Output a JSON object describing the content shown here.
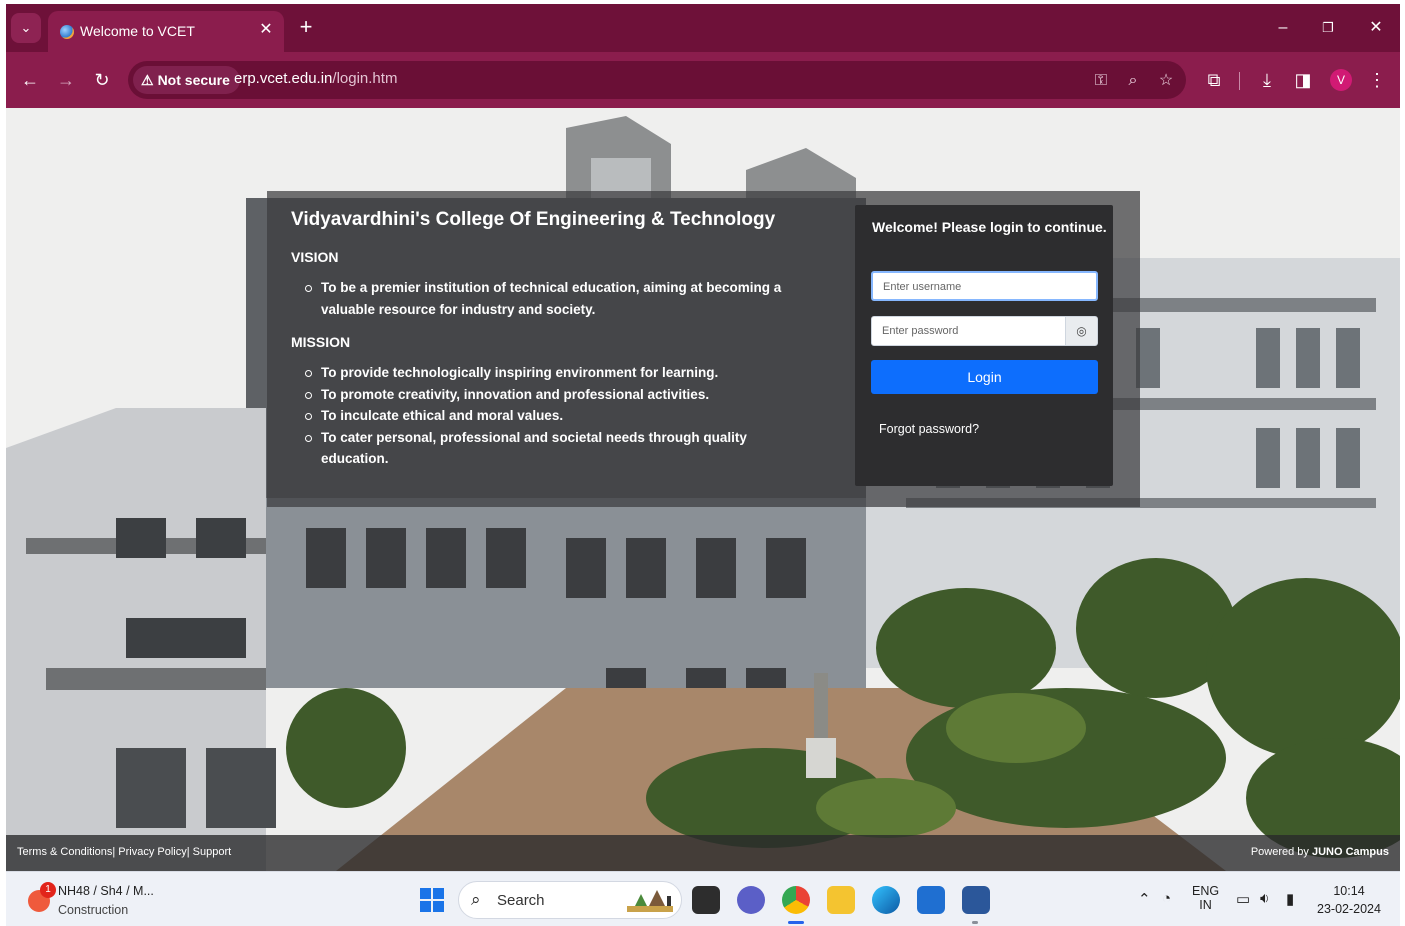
{
  "browser": {
    "tab_title": "Welcome to VCET",
    "security_label": "Not secure",
    "url_host": "erp.vcet.edu.in",
    "url_path": "/login.htm",
    "profile_initial": "V",
    "theme_color": "#8b1d4d"
  },
  "page": {
    "college_name": "Vidyavardhini's College Of Engineering & Technology",
    "vision_heading": "VISION",
    "vision_items": [
      "To be a premier institution of technical education, aiming at becoming a valuable resource for industry and society."
    ],
    "mission_heading": "MISSION",
    "mission_items": [
      "To provide technologically inspiring environment for learning.",
      "To promote creativity, innovation and professional activities.",
      "To inculcate ethical and moral values.",
      "To cater personal, professional and societal needs through quality education."
    ],
    "login": {
      "heading": "Welcome! Please login to continue.",
      "username_placeholder": "Enter username",
      "password_placeholder": "Enter password",
      "login_button": "Login",
      "forgot_password": "Forgot password?"
    },
    "footer_left": "Terms & Conditions| Privacy Policy| Support",
    "footer_powered_prefix": "Powered by ",
    "footer_powered_brand": "JUNO Campus"
  },
  "taskbar": {
    "weather_title": "NH48 / Sh4 / M...",
    "weather_subtitle": "Construction",
    "weather_badge": "1",
    "search_label": "Search",
    "language_top": "ENG",
    "language_bottom": "IN",
    "time": "10:14",
    "date": "23-02-2024"
  }
}
